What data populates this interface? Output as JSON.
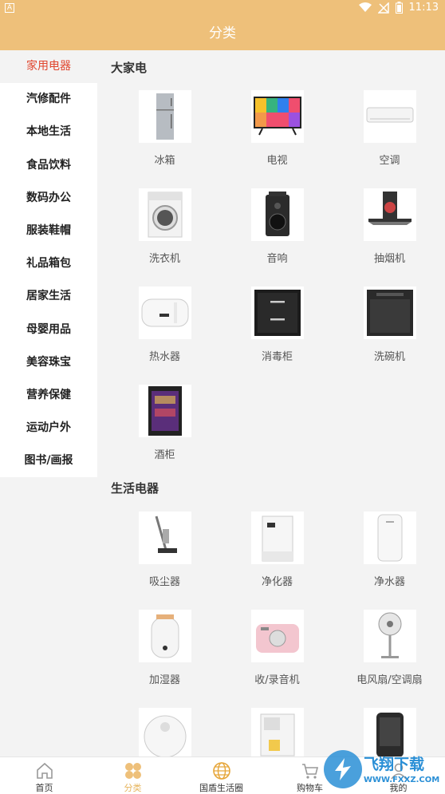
{
  "status": {
    "time": "11:13",
    "app_badge": "A"
  },
  "header": {
    "title": "分类"
  },
  "sidebar": {
    "items": [
      {
        "label": "家用电器",
        "active": true
      },
      {
        "label": "汽修配件"
      },
      {
        "label": "本地生活"
      },
      {
        "label": "食品饮料"
      },
      {
        "label": "数码办公"
      },
      {
        "label": "服装鞋帽"
      },
      {
        "label": "礼品箱包"
      },
      {
        "label": "居家生活"
      },
      {
        "label": "母婴用品"
      },
      {
        "label": "美容珠宝"
      },
      {
        "label": "营养保健"
      },
      {
        "label": "运动户外"
      },
      {
        "label": "图书/画报"
      }
    ]
  },
  "sections": [
    {
      "title": "大家电",
      "items": [
        "冰箱",
        "电视",
        "空调",
        "洗衣机",
        "音响",
        "抽烟机",
        "热水器",
        "消毒柜",
        "洗碗机",
        "酒柜"
      ]
    },
    {
      "title": "生活电器",
      "items": [
        "吸尘器",
        "净化器",
        "净水器",
        "加湿器",
        "收/录音机",
        "电风扇/空调扇",
        "",
        "",
        ""
      ]
    }
  ],
  "tabbar": {
    "tabs": [
      {
        "label": "首页"
      },
      {
        "label": "分类",
        "active": true
      },
      {
        "label": "国盾生活圈"
      },
      {
        "label": "购物车"
      },
      {
        "label": "我的"
      }
    ]
  },
  "watermark": {
    "text": "飞翔下载",
    "url": "WWW.FXXZ.COM"
  },
  "colors": {
    "accent": "#eec07a",
    "active_sidebar": "#e0452d",
    "active_tab": "#e6b45c"
  }
}
